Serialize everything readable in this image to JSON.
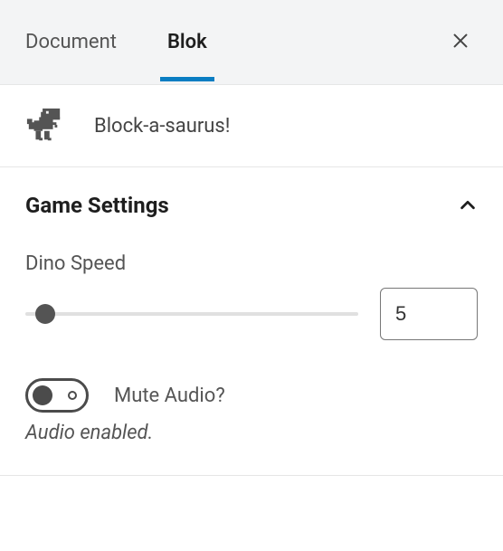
{
  "tabs": {
    "document": "Document",
    "block": "Blok"
  },
  "block_header": {
    "title": "Block-a-saurus!"
  },
  "section": {
    "title": "Game Settings",
    "fields": {
      "dino_speed": {
        "label": "Dino Speed",
        "value": "5",
        "min": 0,
        "max": 100,
        "percent": 5
      },
      "mute_audio": {
        "label": "Mute Audio?",
        "checked": false,
        "help_text": "Audio enabled."
      }
    }
  },
  "colors": {
    "tab_active_underline": "#0a7dc2"
  }
}
